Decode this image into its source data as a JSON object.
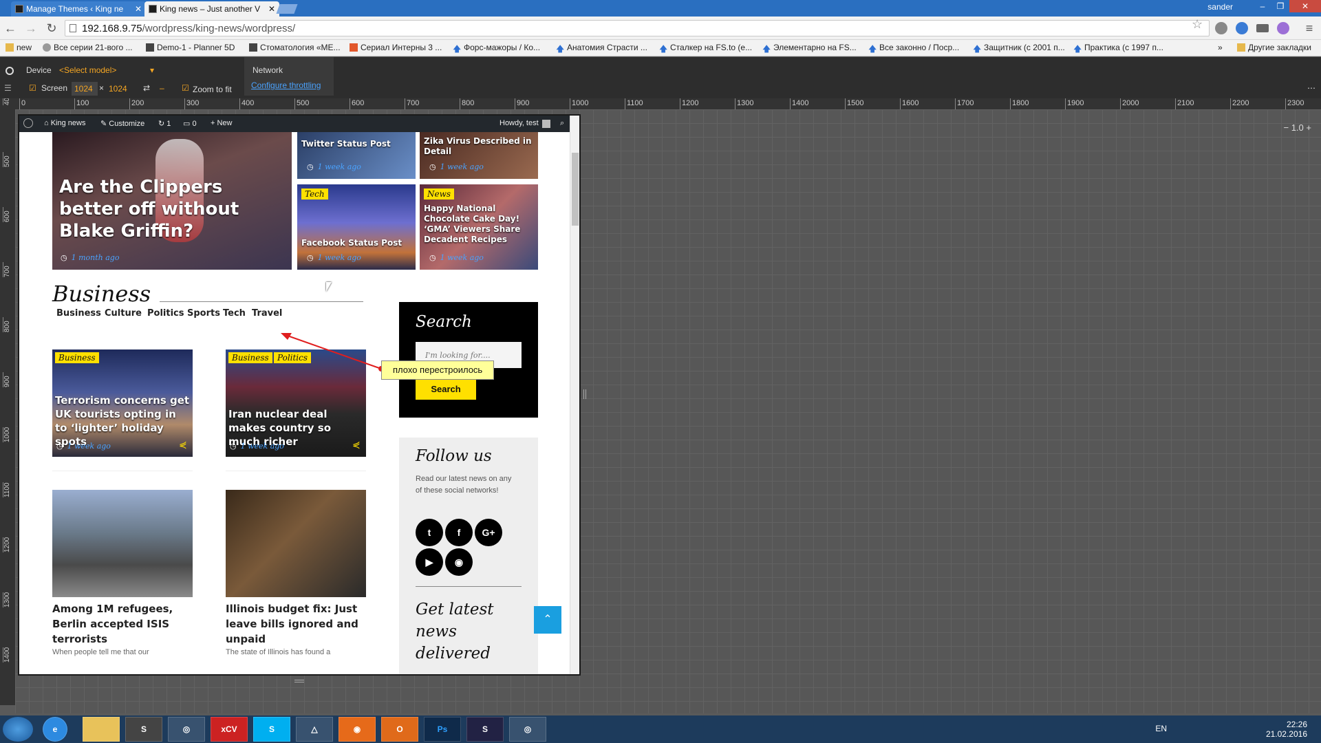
{
  "browser": {
    "tabs": [
      {
        "label": "Manage Themes ‹ King ne",
        "active": false
      },
      {
        "label": "King news – Just another V",
        "active": true
      }
    ],
    "user": "sander",
    "url_host": "192.168.9.75",
    "url_path": "/wordpress/king-news/wordpress/",
    "bookmarks": [
      "new",
      "Все серии 21-вого ...",
      "Demo-1 - Planner 5D",
      "Стоматология «МЕ...",
      "Сериал Интерны 3 ...",
      "Форс-мажоры / Ко...",
      "Анатомия Страсти ...",
      "Сталкер на FS.to (е...",
      "Элементарно на FS...",
      "Все законно / Поср...",
      "Защитник (с 2001 п...",
      "Практика (с 1997 п...",
      "Другие закладки"
    ]
  },
  "devtools": {
    "device_label": "Device",
    "model_select": "<Select model>",
    "screen_label": "Screen",
    "screen_width": "1024",
    "screen_height": "1024",
    "zoom_to_fit": "Zoom to fit",
    "network_label": "Network",
    "throttling_link": "Configure throttling",
    "zoom_value": "1.0",
    "ruler_h": [
      "0",
      "100",
      "200",
      "300",
      "400",
      "500",
      "600",
      "700",
      "800",
      "900",
      "1000",
      "1100",
      "1200",
      "1300",
      "1400",
      "1500",
      "1600",
      "1700",
      "1800",
      "1900",
      "2000",
      "2100",
      "2200",
      "2300"
    ],
    "ruler_v": [
      "400",
      "500",
      "600",
      "700",
      "800",
      "900",
      "1000",
      "1100",
      "1200",
      "1300",
      "1400"
    ]
  },
  "adminbar": {
    "site": "King news",
    "customize": "Customize",
    "updates": "1",
    "comments": "0",
    "new": "New",
    "howdy": "Howdy, test"
  },
  "featured": {
    "main": {
      "title": "Are the Clippers better off without Blake Griffin?",
      "time": "1 month ago"
    },
    "tiles": [
      {
        "title": "Twitter Status Post",
        "time": "1 week ago",
        "tag": ""
      },
      {
        "title": "Zika Virus Described in Detail",
        "time": "1 week ago",
        "tag": ""
      },
      {
        "title": "Facebook Status Post",
        "time": "1 week ago",
        "tag": "Tech"
      },
      {
        "title": "Happy National Chocolate Cake Day! ‘GMA’ Viewers Share Decadent Recipes",
        "time": "1 week ago",
        "tag": "News"
      }
    ]
  },
  "business": {
    "title": "Business",
    "nav": [
      "Business",
      "Culture",
      "Politics",
      "Sports",
      "Tech",
      "Travel"
    ],
    "posts": [
      {
        "title": "Terrorism concerns get UK tourists opting in to ‘lighter’ holiday spots",
        "time": "1 week ago",
        "tags": [
          "Business"
        ]
      },
      {
        "title": "Iran nuclear deal makes country so much richer",
        "time": "1 week ago",
        "tags": [
          "Business",
          "Politics"
        ]
      },
      {
        "title": "Among 1M refugees, Berlin accepted ISIS terrorists",
        "excerpt": "When people tell me that our"
      },
      {
        "title": "Illinois budget fix: Just leave bills ignored and unpaid",
        "excerpt": "The state of Illinois has found a"
      }
    ]
  },
  "sidebar": {
    "search_title": "Search",
    "search_placeholder": "I'm looking for....",
    "search_button": "Search",
    "follow_title": "Follow us",
    "follow_text": "Read our latest news on any of these social networks!",
    "social": [
      "twitter",
      "facebook",
      "google-plus",
      "youtube",
      "rss"
    ],
    "newsletter_title": "Get latest news delivered"
  },
  "annotation": {
    "text": "плохо перестроилось"
  },
  "taskbar": {
    "lang": "EN",
    "time": "22:26",
    "date": "21.02.2016"
  }
}
